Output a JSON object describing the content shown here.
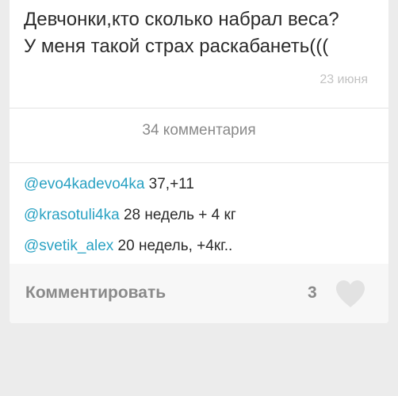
{
  "post": {
    "text_line1": "Девчонки,кто сколько набрал веса?",
    "text_line2": "У меня такой страх раскабанеть(((",
    "date": "23 июня"
  },
  "comments_header": "34 комментария",
  "comments": [
    {
      "author": "@evo4kadevo4ka",
      "text": " 37,+11"
    },
    {
      "author": "@krasotuli4ka",
      "text": " 28 недель + 4 кг"
    },
    {
      "author": "@svetik_alex",
      "text": " 20 недель, +4кг.."
    }
  ],
  "footer": {
    "comment_label": "Комментировать",
    "likes": "3",
    "heart_color": "#e2e2e2",
    "heart_icon": "heart-icon"
  },
  "colors": {
    "author_link": "#2aa2c3",
    "muted_text": "#8a8a8a",
    "date_text": "#c2c2c2"
  }
}
